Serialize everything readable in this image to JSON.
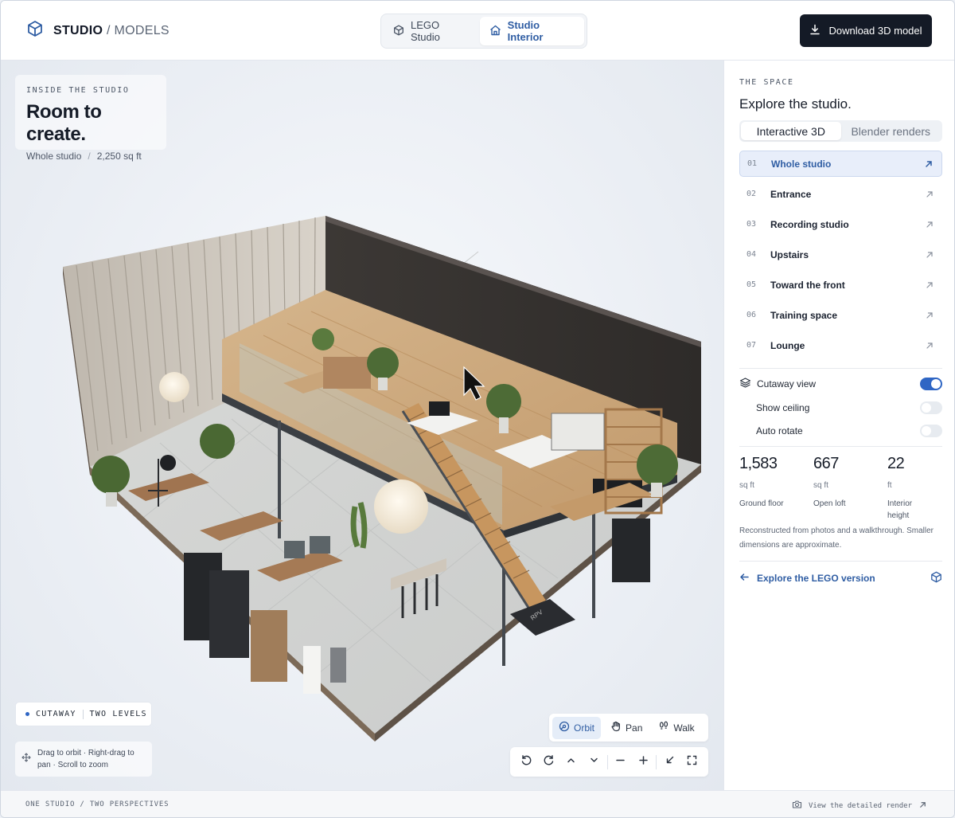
{
  "header": {
    "brand": "STUDIO",
    "brand_separator": "/",
    "brand_section": "MODELS",
    "tabs": [
      {
        "label": "LEGO Studio",
        "icon": "cube-icon",
        "active": false
      },
      {
        "label": "Studio Interior",
        "icon": "home-icon",
        "active": true
      }
    ],
    "download_label": "Download 3D model"
  },
  "viewport": {
    "eyebrow": "INSIDE THE STUDIO",
    "title": "Room to create.",
    "meta_area": "Whole studio",
    "meta_separator": "/",
    "meta_size": "2,250 sq ft",
    "scene_mat_label": "RPV",
    "badge_left": "CUTAWAY",
    "badge_right": "TWO LEVELS",
    "hint": "Drag to orbit · Right-drag to pan · Scroll to zoom",
    "modes": [
      {
        "label": "Orbit",
        "icon": "orbit-icon",
        "active": true
      },
      {
        "label": "Pan",
        "icon": "hand-icon",
        "active": false
      },
      {
        "label": "Walk",
        "icon": "footsteps-icon",
        "active": false
      }
    ],
    "tools": [
      "rotate-left-icon",
      "rotate-right-icon",
      "chevron-up-icon",
      "chevron-down-icon",
      "minus-icon",
      "plus-icon",
      "collapse-icon",
      "fullscreen-icon"
    ]
  },
  "panel": {
    "eyebrow": "THE SPACE",
    "title": "Explore the studio.",
    "view_tabs": [
      {
        "label": "Interactive 3D",
        "active": true
      },
      {
        "label": "Blender renders",
        "active": false
      }
    ],
    "views": [
      {
        "num": "01",
        "label": "Whole studio",
        "active": true
      },
      {
        "num": "02",
        "label": "Entrance",
        "active": false
      },
      {
        "num": "03",
        "label": "Recording studio",
        "active": false
      },
      {
        "num": "04",
        "label": "Upstairs",
        "active": false
      },
      {
        "num": "05",
        "label": "Toward the front",
        "active": false
      },
      {
        "num": "06",
        "label": "Training space",
        "active": false
      },
      {
        "num": "07",
        "label": "Lounge",
        "active": false
      }
    ],
    "toggles": {
      "cutaway": {
        "label": "Cutaway view",
        "on": true
      },
      "ceiling": {
        "label": "Show ceiling",
        "on": false
      },
      "rotate": {
        "label": "Auto rotate",
        "on": false
      }
    },
    "stats": [
      {
        "value": "1,583",
        "unit": "sq ft",
        "label": "Ground floor"
      },
      {
        "value": "667",
        "unit": "sq ft",
        "label": "Open loft"
      },
      {
        "value": "22",
        "unit": "ft",
        "label": "Interior height"
      }
    ],
    "note": "Reconstructed from photos and a walkthrough. Smaller dimensions are approximate.",
    "lego_link": "Explore the LEGO version"
  },
  "footer": {
    "left": "ONE STUDIO / TWO PERSPECTIVES",
    "right": "View the detailed render"
  },
  "colors": {
    "accent": "#2f5da3",
    "toggle_on": "#2f66c4",
    "dark_button": "#141a26"
  }
}
